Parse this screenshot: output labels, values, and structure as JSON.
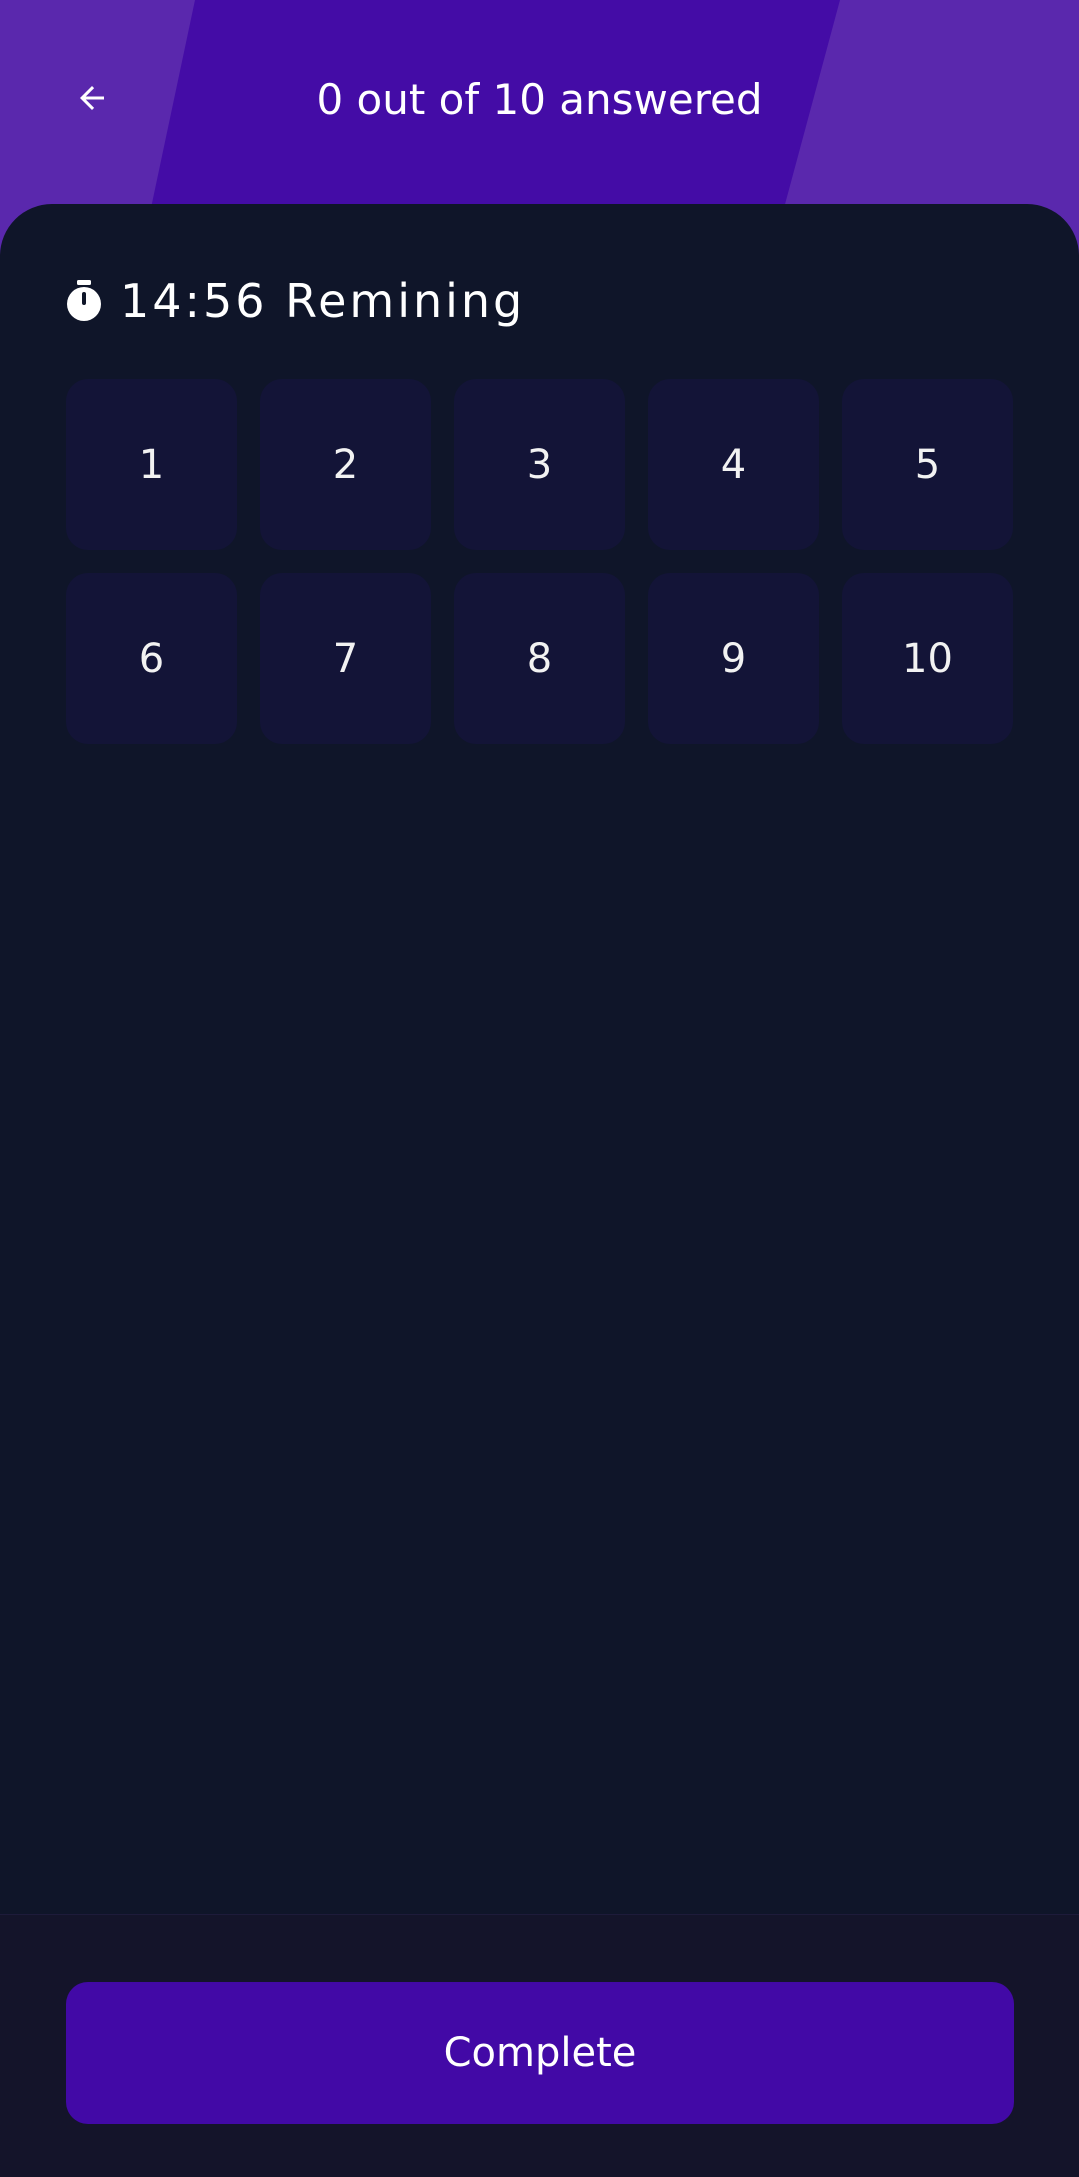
{
  "header": {
    "back_icon": "arrow-left-icon",
    "title": "0 out of 10 answered"
  },
  "timer": {
    "icon": "stopwatch-icon",
    "text": "14:56 Remining"
  },
  "questions": [
    "1",
    "2",
    "3",
    "4",
    "5",
    "6",
    "7",
    "8",
    "9",
    "10"
  ],
  "footer": {
    "complete_label": "Complete"
  },
  "colors": {
    "header_outer": "#5a28ad",
    "header_band": "#440ca6",
    "background": "#0f1529",
    "cell": "#131437",
    "footer": "#14142a",
    "button": "#4209a6"
  }
}
